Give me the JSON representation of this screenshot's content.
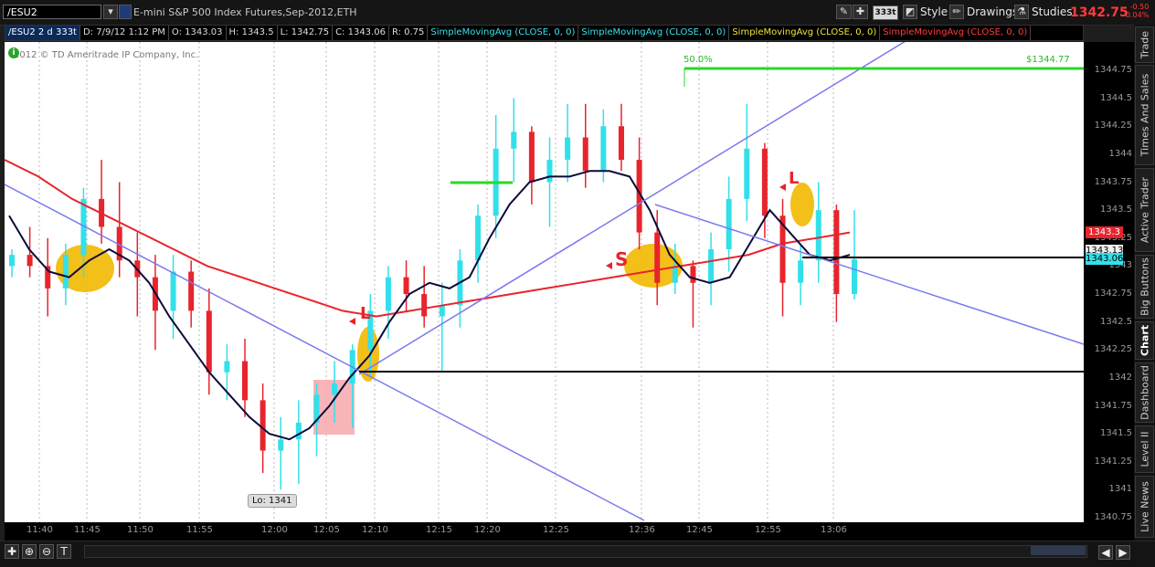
{
  "topbar": {
    "symbol": "/ESU2",
    "description": "E-mini S&P 500 Index Futures,Sep-2012,ETH",
    "aggregation_badge": "333t",
    "style_label": "Style",
    "drawings_label": "Drawings",
    "studies_label": "Studies",
    "last_price": "1342.75",
    "net_change": "-0.50",
    "percent_change": "-0.04%"
  },
  "header_row": {
    "series": "/ESU2 2 d 333t",
    "date": "D: 7/9/12 1:12 PM",
    "open": "O: 1343.03",
    "high": "H: 1343.5",
    "low": "L: 1342.75",
    "close": "C: 1343.06",
    "range": "R: 0.75",
    "study1": "SimpleMovingAvg (CLOSE, 0, 0)",
    "study2": "SimpleMovingAvg (CLOSE, 0, 0)",
    "study3": "SimpleMovingAvg (CLOSE, 0, 0)",
    "study4": "SimpleMovingAvg (CLOSE, 0, 0)"
  },
  "chart": {
    "copyright": "2012 © TD Ameritrade IP Company, Inc.",
    "fib_label": "50.0%",
    "fib_price_label": "$1344.77",
    "low_label": "Lo: 1341",
    "marker_L1": "L",
    "marker_L2": "L",
    "marker_S": "S"
  },
  "price_axis": {
    "ticks": [
      "1344.75",
      "1344.5",
      "1344.25",
      "1344",
      "1343.75",
      "1343.5",
      "1343.25",
      "1343",
      "1342.75",
      "1342.5",
      "1342.25",
      "1342",
      "1341.75",
      "1341.5",
      "1341.25",
      "1341",
      "1340.75"
    ],
    "bubble_red": "1343.3",
    "bubble_white": "1343.13",
    "bubble_cyan": "1343.06"
  },
  "time_axis": {
    "labels": [
      "11:40",
      "11:45",
      "11:50",
      "11:55",
      "12:00",
      "12:05",
      "12:10",
      "12:15",
      "12:20",
      "12:25",
      "12:36",
      "12:45",
      "12:55",
      "13:06"
    ]
  },
  "sidebar": {
    "tabs": [
      "Trade",
      "Times And Sales",
      "Active Trader",
      "Big Buttons",
      "Chart",
      "Dashboard",
      "Level II",
      "Live News"
    ]
  },
  "chart_data": {
    "type": "bar",
    "y_range": [
      1340.75,
      1344.75
    ],
    "up_color": "#33e0ea",
    "down_color": "#e8242c",
    "ma_fast_color": "#0b0b3a",
    "ma_slow_color": "#e8242c",
    "trendline_color": "#7a7aee",
    "grid": "vertical dashed",
    "bars": [
      {
        "o": 1343.0,
        "h": 1343.15,
        "l": 1342.9,
        "c": 1343.1
      },
      {
        "o": 1343.1,
        "h": 1343.35,
        "l": 1342.9,
        "c": 1343.0
      },
      {
        "o": 1343.0,
        "h": 1343.25,
        "l": 1342.55,
        "c": 1342.8
      },
      {
        "o": 1342.8,
        "h": 1343.2,
        "l": 1342.65,
        "c": 1343.1
      },
      {
        "o": 1343.1,
        "h": 1343.7,
        "l": 1342.9,
        "c": 1343.6
      },
      {
        "o": 1343.6,
        "h": 1343.95,
        "l": 1343.2,
        "c": 1343.35
      },
      {
        "o": 1343.35,
        "h": 1343.75,
        "l": 1342.9,
        "c": 1343.05
      },
      {
        "o": 1343.05,
        "h": 1343.3,
        "l": 1342.55,
        "c": 1342.9
      },
      {
        "o": 1342.9,
        "h": 1343.1,
        "l": 1342.25,
        "c": 1342.6
      },
      {
        "o": 1342.6,
        "h": 1343.1,
        "l": 1342.35,
        "c": 1342.95
      },
      {
        "o": 1342.95,
        "h": 1343.05,
        "l": 1342.45,
        "c": 1342.6
      },
      {
        "o": 1342.6,
        "h": 1342.8,
        "l": 1341.85,
        "c": 1342.05
      },
      {
        "o": 1342.05,
        "h": 1342.3,
        "l": 1341.8,
        "c": 1342.15
      },
      {
        "o": 1342.15,
        "h": 1342.35,
        "l": 1341.65,
        "c": 1341.8
      },
      {
        "o": 1341.8,
        "h": 1341.95,
        "l": 1341.15,
        "c": 1341.35
      },
      {
        "o": 1341.35,
        "h": 1341.65,
        "l": 1341.0,
        "c": 1341.45
      },
      {
        "o": 1341.45,
        "h": 1341.8,
        "l": 1341.05,
        "c": 1341.6
      },
      {
        "o": 1341.6,
        "h": 1341.95,
        "l": 1341.3,
        "c": 1341.85
      },
      {
        "o": 1341.85,
        "h": 1342.15,
        "l": 1341.6,
        "c": 1341.95
      },
      {
        "o": 1341.95,
        "h": 1342.3,
        "l": 1341.55,
        "c": 1342.25
      },
      {
        "o": 1342.25,
        "h": 1342.75,
        "l": 1342.0,
        "c": 1342.6
      },
      {
        "o": 1342.6,
        "h": 1343.0,
        "l": 1342.35,
        "c": 1342.9
      },
      {
        "o": 1342.9,
        "h": 1343.05,
        "l": 1342.6,
        "c": 1342.75
      },
      {
        "o": 1342.75,
        "h": 1343.0,
        "l": 1342.45,
        "c": 1342.55
      },
      {
        "o": 1342.55,
        "h": 1342.85,
        "l": 1342.05,
        "c": 1342.65
      },
      {
        "o": 1342.65,
        "h": 1343.15,
        "l": 1342.45,
        "c": 1343.05
      },
      {
        "o": 1343.05,
        "h": 1343.55,
        "l": 1342.85,
        "c": 1343.45
      },
      {
        "o": 1343.45,
        "h": 1344.35,
        "l": 1343.25,
        "c": 1344.05
      },
      {
        "o": 1344.05,
        "h": 1344.5,
        "l": 1343.75,
        "c": 1344.2
      },
      {
        "o": 1344.2,
        "h": 1344.25,
        "l": 1343.55,
        "c": 1343.75
      },
      {
        "o": 1343.75,
        "h": 1344.15,
        "l": 1343.35,
        "c": 1343.95
      },
      {
        "o": 1343.95,
        "h": 1344.45,
        "l": 1343.75,
        "c": 1344.15
      },
      {
        "o": 1344.15,
        "h": 1344.45,
        "l": 1343.7,
        "c": 1343.85
      },
      {
        "o": 1343.85,
        "h": 1344.4,
        "l": 1343.75,
        "c": 1344.25
      },
      {
        "o": 1344.25,
        "h": 1344.45,
        "l": 1343.85,
        "c": 1343.95
      },
      {
        "o": 1343.95,
        "h": 1344.15,
        "l": 1343.15,
        "c": 1343.3
      },
      {
        "o": 1343.3,
        "h": 1343.5,
        "l": 1342.65,
        "c": 1342.85
      },
      {
        "o": 1342.85,
        "h": 1343.2,
        "l": 1342.75,
        "c": 1343.0
      },
      {
        "o": 1343.0,
        "h": 1343.05,
        "l": 1342.45,
        "c": 1342.85
      },
      {
        "o": 1342.85,
        "h": 1343.3,
        "l": 1342.65,
        "c": 1343.15
      },
      {
        "o": 1343.15,
        "h": 1343.8,
        "l": 1342.95,
        "c": 1343.6
      },
      {
        "o": 1343.6,
        "h": 1344.45,
        "l": 1343.4,
        "c": 1344.05
      },
      {
        "o": 1344.05,
        "h": 1344.1,
        "l": 1343.25,
        "c": 1343.45
      },
      {
        "o": 1343.45,
        "h": 1343.6,
        "l": 1342.55,
        "c": 1342.85
      },
      {
        "o": 1342.85,
        "h": 1343.2,
        "l": 1342.65,
        "c": 1343.05
      },
      {
        "o": 1343.05,
        "h": 1343.75,
        "l": 1342.85,
        "c": 1343.5
      },
      {
        "o": 1343.5,
        "h": 1343.55,
        "l": 1342.5,
        "c": 1342.75
      },
      {
        "o": 1342.75,
        "h": 1343.5,
        "l": 1342.7,
        "c": 1343.06
      }
    ],
    "sma_fast": [
      1343.45,
      1343.15,
      1342.95,
      1342.9,
      1343.05,
      1343.15,
      1343.05,
      1342.85,
      1342.55,
      1342.3,
      1342.05,
      1341.85,
      1341.65,
      1341.5,
      1341.45,
      1341.55,
      1341.75,
      1342.0,
      1342.2,
      1342.5,
      1342.75,
      1342.85,
      1342.8,
      1342.9,
      1343.25,
      1343.55,
      1343.75,
      1343.8,
      1343.8,
      1343.85,
      1343.85,
      1343.8,
      1343.5,
      1343.1,
      1342.9,
      1342.85,
      1342.9,
      1343.2,
      1343.5,
      1343.3,
      1343.1,
      1343.05,
      1343.1
    ],
    "sma_slow": [
      1343.95,
      1343.8,
      1343.6,
      1343.45,
      1343.3,
      1343.15,
      1343.0,
      1342.9,
      1342.8,
      1342.7,
      1342.6,
      1342.55,
      1342.6,
      1342.65,
      1342.7,
      1342.75,
      1342.8,
      1342.85,
      1342.9,
      1342.95,
      1343.0,
      1343.05,
      1343.1,
      1343.2,
      1343.25,
      1343.3
    ]
  }
}
